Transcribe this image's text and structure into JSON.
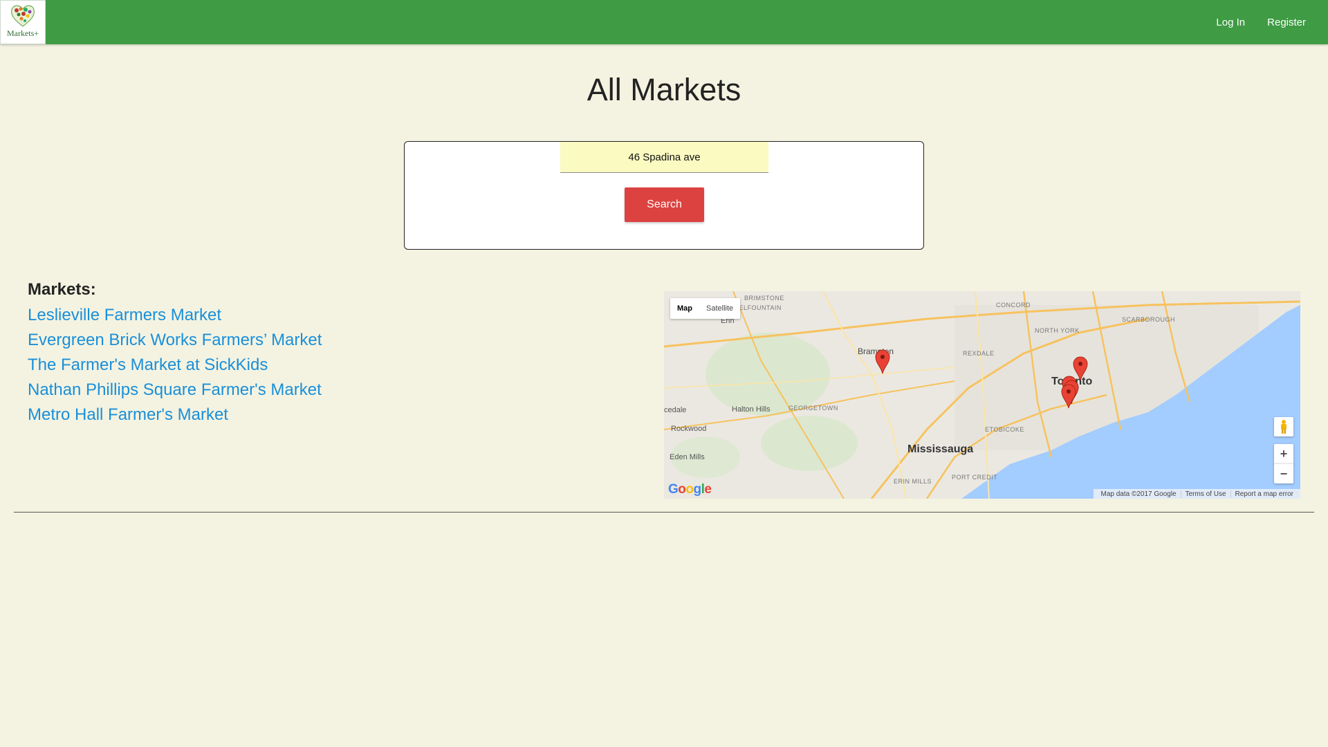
{
  "navbar": {
    "logo_text": "Markets+",
    "login_label": "Log In",
    "register_label": "Register"
  },
  "page": {
    "title": "All Markets"
  },
  "search": {
    "value": "46 Spadina ave",
    "button_label": "Search"
  },
  "markets": {
    "heading": "Markets:",
    "items": [
      "Leslieville Farmers Market",
      "Evergreen Brick Works Farmers’ Market",
      "The Farmer's Market at SickKids",
      "Nathan Phillips Square Farmer's Market",
      "Metro Hall Farmer's Market"
    ]
  },
  "map": {
    "type_map": "Map",
    "type_satellite": "Satellite",
    "zoom_in": "+",
    "zoom_out": "−",
    "attribution": "Map data ©2017 Google",
    "terms": "Terms of Use",
    "report": "Report a map error",
    "labels": {
      "toronto": "Toronto",
      "mississauga": "Mississauga",
      "brampton": "Brampton",
      "halton_hills": "Halton Hills",
      "rockwood": "Rockwood",
      "eden_mills": "Eden Mills",
      "erin": "Erin",
      "georgetown": "GEORGETOWN",
      "etobicoke": "ETOBICOKE",
      "north_york": "NORTH YORK",
      "scarborough": "SCARBOROUGH",
      "concord": "CONCORD",
      "rexdale": "REXDALE",
      "brimstone": "BRIMSTONE",
      "belfountain": "BELFOUNTAIN",
      "erin_mills": "ERIN MILLS",
      "port_credit": "PORT CREDIT",
      "cedale": "cedale"
    },
    "colors": {
      "water": "#a3ccff",
      "land": "#ebe8e1",
      "highway": "#f7c25e",
      "park": "#cfe6c2",
      "pin": "#e94235"
    }
  },
  "theme": {
    "nav_green": "#3f9b44",
    "background": "#f4f3e1",
    "link_blue": "#1a8fd9",
    "button_red": "#dc4240",
    "input_yellow": "#fafac1"
  }
}
